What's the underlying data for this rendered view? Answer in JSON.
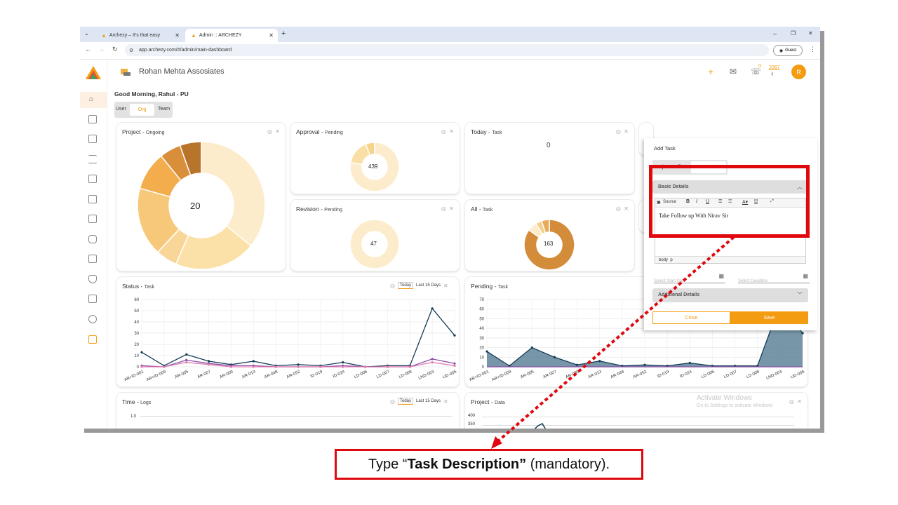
{
  "browser": {
    "tabs": [
      {
        "title": "Archezy – It's that easy"
      },
      {
        "title": "Admin :: ARCHEZY"
      }
    ],
    "url": "app.archezy.com/#/admin/main-dashboard",
    "profile": "Guest"
  },
  "header": {
    "company": "Rohan Mehta Assosiates",
    "notif_count": "0",
    "bell_count": "2067",
    "avatar": "R",
    "logo_caption": "ARCHEZY"
  },
  "greeting": "Good Morning, Rahul - PU",
  "scope_toggle": [
    "User",
    "Org",
    "Team"
  ],
  "cards": {
    "project": {
      "title": "Project",
      "sub": "Ongoing",
      "value": "20"
    },
    "approval": {
      "title": "Approval",
      "sub": "Pending",
      "value": "439"
    },
    "today": {
      "title": "Today",
      "sub": "Task",
      "value": "0"
    },
    "revision": {
      "title": "Revision",
      "sub": "Pending",
      "value": "47"
    },
    "all": {
      "title": "All",
      "sub": "Task",
      "value": "163"
    },
    "status": {
      "title": "Status",
      "sub": "Task"
    },
    "pending": {
      "title": "Pending",
      "sub": "Task"
    },
    "time": {
      "title": "Time",
      "sub": "Logs",
      "y_top": "1.0"
    },
    "projectdata": {
      "title": "Project",
      "sub": "Data",
      "y_top": "400",
      "y_next": "350"
    }
  },
  "range_buttons": {
    "today": "Today",
    "last15": "Last 15 Days"
  },
  "watermark": {
    "line1": "Activate Windows",
    "line2": "Go to Settings to activate Windows"
  },
  "add_task": {
    "title": "Add Task",
    "types": [
      "Project",
      "Office",
      "Personal"
    ],
    "basic_details": "Basic Details",
    "toolbar_source": "Source",
    "editor_text": "Take Follow up With Nirav Sir",
    "statusbar": "body  p",
    "start_date_placeholder": "Select Start Date",
    "deadline_placeholder": "Select Deadline",
    "additional_details": "Additional Details",
    "close": "Close",
    "save": "Save"
  },
  "callout": {
    "pre": "Type “",
    "bold": "Task Description”",
    "post": " (mandatory)."
  },
  "chart_data": [
    {
      "type": "line",
      "title": "Status - Task",
      "x": [
        "AR+ID-001",
        "AR+ID-009",
        "AR-005",
        "AR-007",
        "AR-009",
        "AR-013",
        "AR-048",
        "AR-052",
        "ID-019",
        "ID-024",
        "LD-006",
        "LD-007",
        "LD-008",
        "LND-003",
        "UD-005"
      ],
      "ylim": [
        0,
        60
      ],
      "yticks": [
        0,
        10,
        20,
        30,
        40,
        50,
        60
      ],
      "series": [
        {
          "color": "#123b55",
          "values": [
            13,
            1,
            11,
            5,
            2,
            5,
            1,
            2,
            1,
            4,
            0,
            1,
            1,
            52,
            28
          ]
        },
        {
          "color": "#8a4fa8",
          "values": [
            1,
            0,
            6,
            3,
            1,
            1,
            0,
            0,
            0,
            1,
            0,
            0,
            0,
            7,
            3
          ]
        },
        {
          "color": "#e07ab0",
          "values": [
            0,
            0,
            4,
            2,
            0,
            0,
            0,
            0,
            0,
            0,
            0,
            0,
            0,
            4,
            1
          ]
        }
      ]
    },
    {
      "type": "area",
      "title": "Pending - Task",
      "x": [
        "AR+ID-001",
        "AR+ID-009",
        "AR-005",
        "AR-007",
        "AR-009",
        "AR-013",
        "AR-048",
        "AR-052",
        "ID-019",
        "ID-024",
        "LD-006",
        "LD-007",
        "LD-008",
        "LND-003",
        "UD-005"
      ],
      "ylim": [
        0,
        70
      ],
      "yticks": [
        0,
        10,
        20,
        30,
        40,
        50,
        60,
        70
      ],
      "series": [
        {
          "color": "#123b55",
          "values": [
            16,
            1,
            20,
            10,
            2,
            6,
            1,
            2,
            1,
            4,
            1,
            1,
            1,
            65,
            35
          ]
        }
      ]
    },
    {
      "type": "pie",
      "title": "Project - Ongoing",
      "values": [
        33,
        19,
        5,
        16,
        9,
        5,
        5
      ],
      "colors": [
        "#fdeccb",
        "#fbe1a8",
        "#f9d697",
        "#f7c87a",
        "#f3ad4c",
        "#d98e3a",
        "#b8742b"
      ]
    },
    {
      "type": "pie",
      "title": "Approval - Pending",
      "values": [
        78,
        16,
        6
      ],
      "colors": [
        "#fdeccb",
        "#f9dfa6",
        "#f6d48c"
      ]
    },
    {
      "type": "pie",
      "title": "Revision - Pending",
      "values": [
        100
      ],
      "colors": [
        "#fdeccb"
      ]
    },
    {
      "type": "pie",
      "title": "All - Task",
      "values": [
        85,
        6,
        4,
        5
      ],
      "colors": [
        "#d38c3a",
        "#fdeccb",
        "#f5cf8a",
        "#e7ac5b"
      ]
    }
  ]
}
